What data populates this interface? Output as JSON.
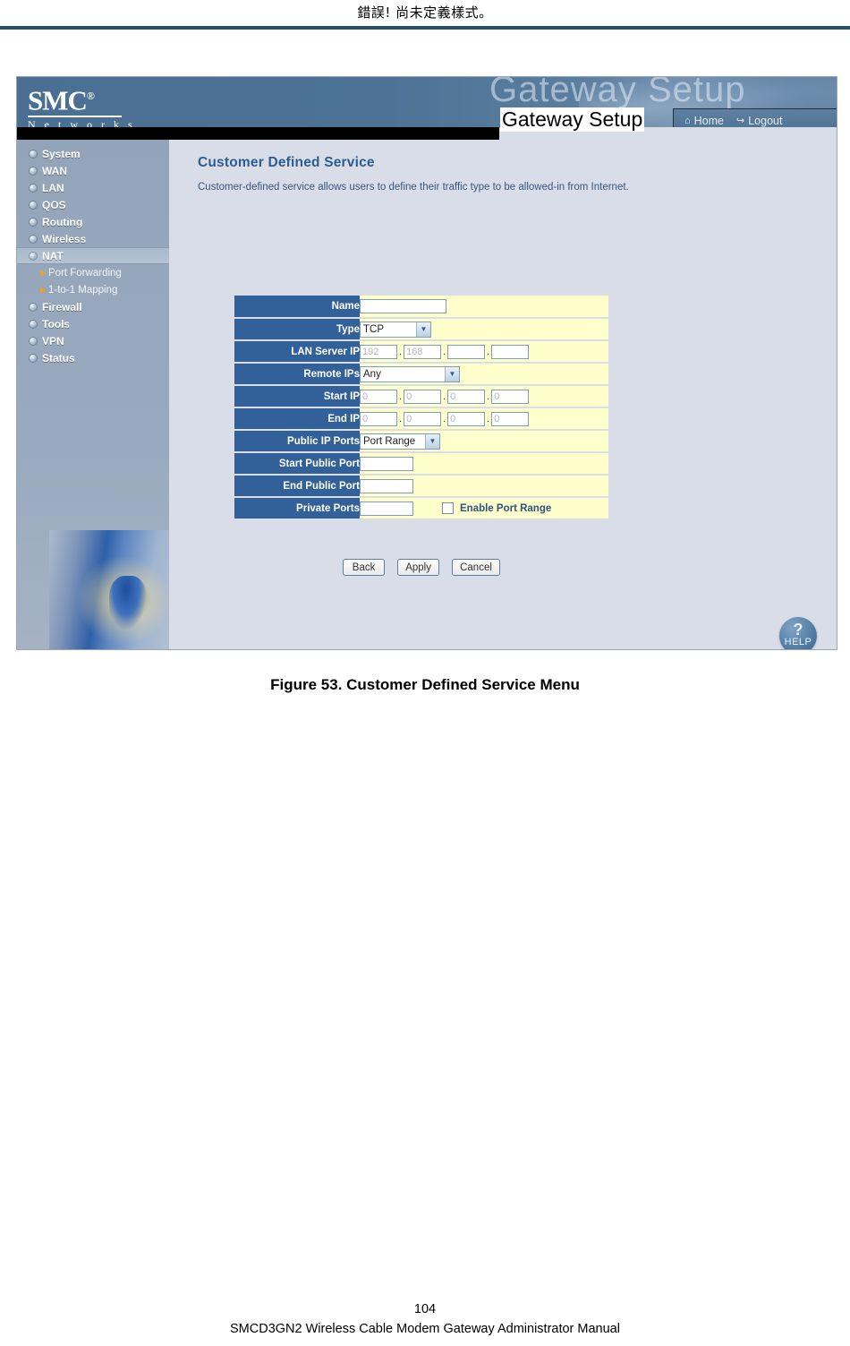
{
  "document": {
    "header_text": "錯誤! 尚未定義樣式。",
    "caption": "Figure 53. Customer Defined Service Menu",
    "page_number": "104",
    "footer_text": "SMCD3GN2 Wireless Cable Modem Gateway Administrator Manual"
  },
  "banner": {
    "logo_main": "SMC",
    "logo_reg": "®",
    "logo_sub": "N e t w o r k s",
    "watermark": "Gateway Setup",
    "title": "Gateway Setup",
    "nav": [
      {
        "label": "Home",
        "icon": "home-icon",
        "glyph": "⌂"
      },
      {
        "label": "Logout",
        "icon": "logout-icon",
        "glyph": "↪"
      }
    ]
  },
  "sidebar": {
    "items": [
      {
        "label": "System",
        "active": false
      },
      {
        "label": "WAN",
        "active": false
      },
      {
        "label": "LAN",
        "active": false
      },
      {
        "label": "QOS",
        "active": false
      },
      {
        "label": "Routing",
        "active": false
      },
      {
        "label": "Wireless",
        "active": false
      },
      {
        "label": "NAT",
        "active": true
      },
      {
        "label": "Firewall",
        "active": false
      },
      {
        "label": "Tools",
        "active": false
      },
      {
        "label": "VPN",
        "active": false
      },
      {
        "label": "Status",
        "active": false
      }
    ],
    "submenu": [
      {
        "label": "Port Forwarding"
      },
      {
        "label": "1-to-1 Mapping"
      }
    ]
  },
  "main": {
    "title": "Customer Defined Service",
    "description": "Customer-defined service allows users to define their traffic type to be allowed-in from Internet.",
    "fields": {
      "name": {
        "label": "Name",
        "value": ""
      },
      "type": {
        "label": "Type",
        "value": "TCP"
      },
      "lan_server_ip": {
        "label": "LAN Server IP",
        "octets": [
          "",
          "",
          "",
          ""
        ],
        "placeholders": [
          "192",
          "168",
          "",
          ""
        ]
      },
      "remote_ips": {
        "label": "Remote IPs",
        "value": "Any"
      },
      "start_ip": {
        "label": "Start IP",
        "octets": [
          "",
          "",
          "",
          ""
        ],
        "placeholders": [
          "0",
          "0",
          "0",
          "0"
        ]
      },
      "end_ip": {
        "label": "End IP",
        "octets": [
          "",
          "",
          "",
          ""
        ],
        "placeholders": [
          "0",
          "0",
          "0",
          "0"
        ]
      },
      "public_ip_ports": {
        "label": "Public IP Ports",
        "value": "Port Range"
      },
      "start_public_port": {
        "label": "Start Public Port",
        "value": ""
      },
      "end_public_port": {
        "label": "End Public Port",
        "value": ""
      },
      "private_ports": {
        "label": "Private Ports",
        "value": "",
        "checkbox_label": "Enable Port Range",
        "checked": false
      }
    },
    "buttons": {
      "back": "Back",
      "apply": "Apply",
      "cancel": "Cancel"
    },
    "help": {
      "glyph": "?",
      "label": "HELP"
    }
  },
  "colors": {
    "label_cell": "#326199",
    "field_bg": "#ffffcc",
    "content_bg": "#d9dde8",
    "accent": "#2b5c92",
    "rule": "#27506e"
  }
}
